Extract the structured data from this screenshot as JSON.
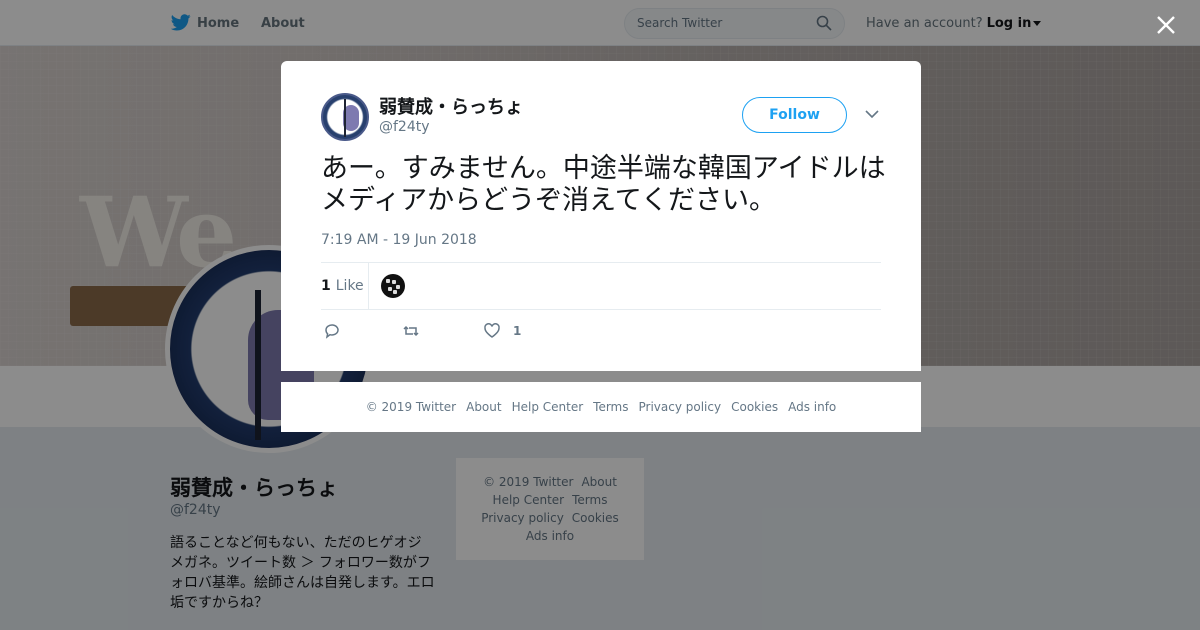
{
  "nav": {
    "home_label": "Home",
    "about_label": "About",
    "search_placeholder": "Search Twitter",
    "account_prompt": "Have an account?",
    "login_label": "Log in"
  },
  "banner": {
    "word": "We"
  },
  "profile": {
    "name": "弱賛成・らっちょ",
    "handle": "@f24ty",
    "bio": "語ることなど何もない、ただのヒゲオジメガネ。ツイート数 ＞ フォロワー数がフォロバ基準。絵師さんは自発します。エロ垢ですからね？"
  },
  "side_footer": {
    "copyright": "© 2019 Twitter",
    "about": "About",
    "help": "Help Center",
    "terms": "Terms",
    "privacy": "Privacy policy",
    "cookies": "Cookies",
    "ads": "Ads info"
  },
  "tweet": {
    "author_name": "弱賛成・らっちょ",
    "author_handle": "@f24ty",
    "follow_label": "Follow",
    "text": "あー。すみません。中途半端な韓国アイドルはメディアからどうぞ消えてください。",
    "timestamp": "7:19 AM - 19 Jun 2018",
    "like_count": "1",
    "like_label": "Like",
    "action_like_count": "1"
  },
  "modal_footer": {
    "copyright": "© 2019 Twitter",
    "about": "About",
    "help": "Help Center",
    "terms": "Terms",
    "privacy": "Privacy policy",
    "cookies": "Cookies",
    "ads": "Ads info"
  },
  "colors": {
    "accent": "#1da1f2",
    "text": "#14171a",
    "muted": "#657786"
  }
}
